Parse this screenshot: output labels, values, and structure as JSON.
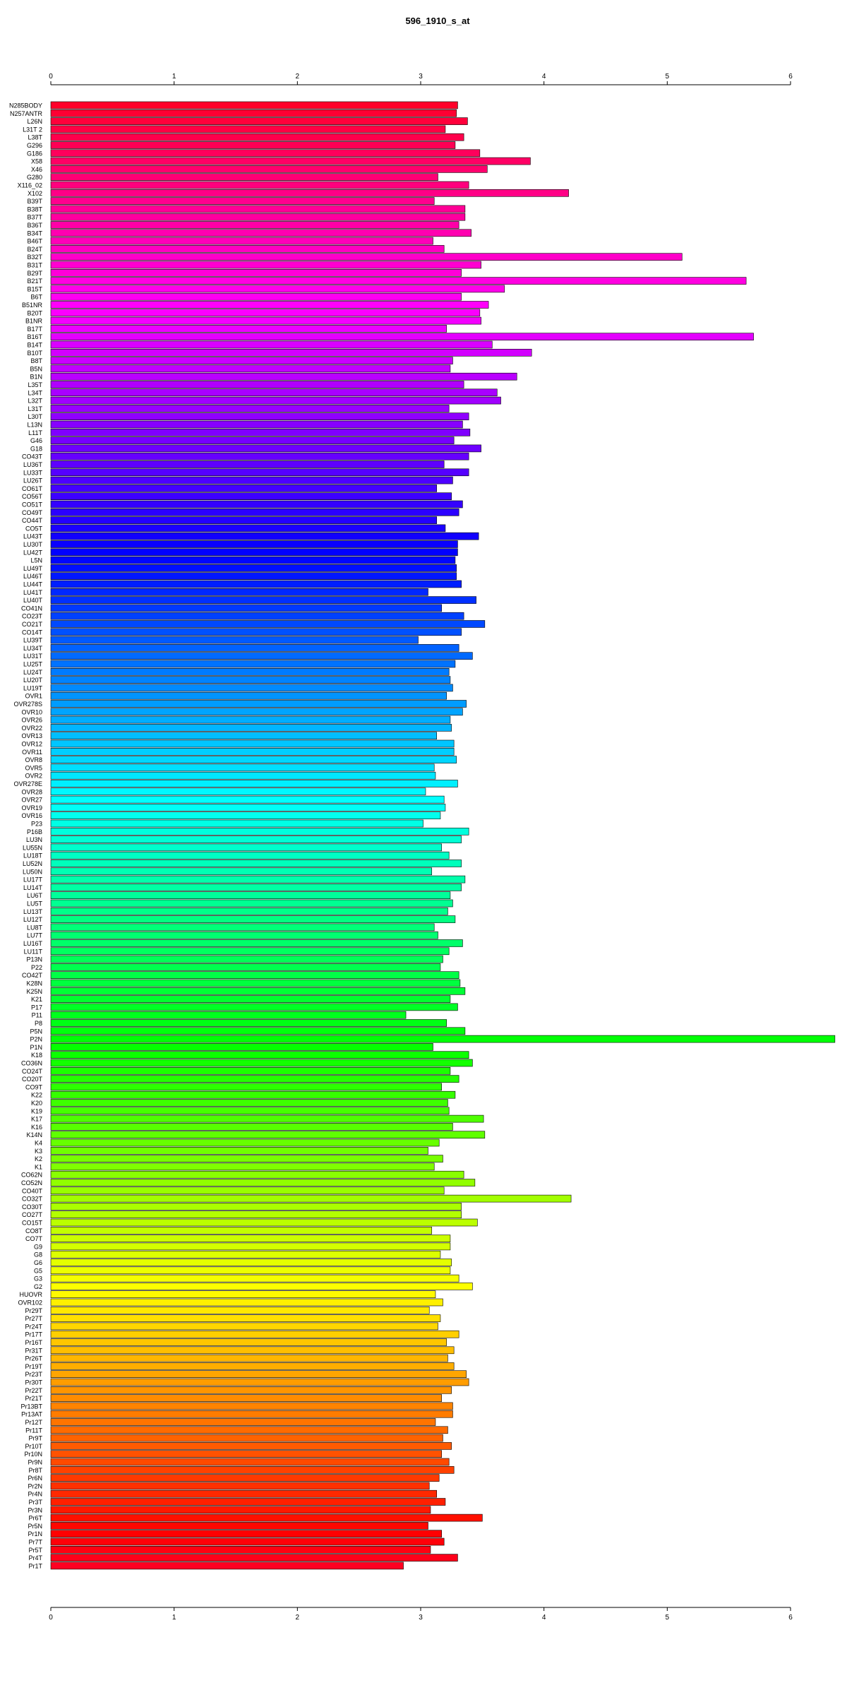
{
  "chart_data": {
    "type": "bar",
    "orientation": "horizontal",
    "title": "596_1910_s_at",
    "xlabel": "",
    "ylabel": "",
    "xlim": [
      0,
      6
    ],
    "xticks": [
      0,
      1,
      2,
      3,
      4,
      5,
      6
    ],
    "grid": false,
    "legend": "none",
    "categories": [
      "N285BODY",
      "N257ANTR",
      "L26N",
      "L31T 2",
      "L38T",
      "G296",
      "G186",
      "X58",
      "X46",
      "G280",
      "X116_02",
      "X102",
      "B39T",
      "B38T",
      "B37T",
      "B36T",
      "B34T",
      "B46T",
      "B24T",
      "B32T",
      "B31T",
      "B29T",
      "B21T",
      "B15T",
      "B6T",
      "B51NR",
      "B20T",
      "B1NR",
      "B17T",
      "B16T",
      "B14T",
      "B10T",
      "B8T",
      "B5N",
      "B1N",
      "L35T",
      "L34T",
      "L32T",
      "L31T",
      "L30T",
      "L13N",
      "L11T",
      "G46",
      "G18",
      "CO43T",
      "LU36T",
      "LU33T",
      "LU26T",
      "CO61T",
      "CO56T",
      "CO51T",
      "CO49T",
      "CO44T",
      "CO5T",
      "LU43T",
      "LU30T",
      "LU42T",
      "L5N",
      "LU49T",
      "LU46T",
      "LU44T",
      "LU41T",
      "LU40T",
      "CO41N",
      "CO23T",
      "CO21T",
      "CO14T",
      "LU39T",
      "LU34T",
      "LU31T",
      "LU25T",
      "LU24T",
      "LU20T",
      "LU19T",
      "OVR1",
      "OVR278S",
      "OVR10",
      "OVR26",
      "OVR22",
      "OVR13",
      "OVR12",
      "OVR11",
      "OVR8",
      "OVR5",
      "OVR2",
      "OVR278E",
      "OVR28",
      "OVR27",
      "OVR19",
      "OVR16",
      "P23",
      "P16B",
      "LU3N",
      "LU55N",
      "LU18T",
      "LU52N",
      "LU50N",
      "LU17T",
      "LU14T",
      "LU6T",
      "LU5T",
      "LU13T",
      "LU12T",
      "LU8T",
      "LU7T",
      "LU16T",
      "LU11T",
      "P13N",
      "P22",
      "CO42T",
      "K28N",
      "K25N",
      "K21",
      "P17",
      "P11",
      "P8",
      "P5N",
      "P2N",
      "P1N",
      "K18",
      "CO36N",
      "CO24T",
      "CO20T",
      "CO9T",
      "K22",
      "K20",
      "K19",
      "K17",
      "K16",
      "K14N",
      "K4",
      "K3",
      "K2",
      "K1",
      "CO62N",
      "CO52N",
      "CO40T",
      "CO32T",
      "CO30T",
      "CO27T",
      "CO15T",
      "CO8T",
      "CO7T",
      "G9",
      "G8",
      "G6",
      "G5",
      "G3",
      "G2",
      "HUOVR",
      "OVR102",
      "Pr29T",
      "Pr27T",
      "Pr24T",
      "Pr17T",
      "Pr16T",
      "Pr31T",
      "Pr26T",
      "Pr19T",
      "Pr23T",
      "Pr30T",
      "Pr22T",
      "Pr21T",
      "Pr13BT",
      "Pr13AT",
      "Pr12T",
      "Pr11T",
      "Pr9T",
      "Pr10T",
      "Pr10N",
      "Pr9N",
      "Pr8T",
      "Pr6N",
      "Pr2N",
      "Pr4N",
      "Pr3T",
      "Pr3N",
      "Pr6T",
      "Pr5N",
      "Pr1N",
      "Pr7T",
      "Pr5T",
      "Pr4T",
      "Pr1T"
    ],
    "values": [
      3.3,
      3.29,
      3.38,
      3.2,
      3.35,
      3.28,
      3.48,
      3.89,
      3.54,
      3.14,
      3.39,
      4.2,
      3.11,
      3.36,
      3.36,
      3.31,
      3.41,
      3.1,
      3.19,
      5.12,
      3.49,
      3.33,
      5.64,
      3.68,
      3.33,
      3.55,
      3.48,
      3.49,
      3.21,
      5.7,
      3.58,
      3.9,
      3.26,
      3.24,
      3.78,
      3.35,
      3.62,
      3.65,
      3.23,
      3.39,
      3.34,
      3.4,
      3.27,
      3.49,
      3.39,
      3.19,
      3.39,
      3.26,
      3.13,
      3.25,
      3.34,
      3.31,
      3.13,
      3.2,
      3.47,
      3.3,
      3.3,
      3.28,
      3.29,
      3.29,
      3.33,
      3.06,
      3.45,
      3.17,
      3.35,
      3.52,
      3.33,
      2.98,
      3.31,
      3.42,
      3.28,
      3.23,
      3.24,
      3.26,
      3.21,
      3.37,
      3.34,
      3.24,
      3.25,
      3.13,
      3.27,
      3.27,
      3.29,
      3.11,
      3.12,
      3.3,
      3.04,
      3.19,
      3.2,
      3.16,
      3.02,
      3.39,
      3.33,
      3.17,
      3.23,
      3.33,
      3.09,
      3.36,
      3.33,
      3.24,
      3.26,
      3.22,
      3.28,
      3.11,
      3.14,
      3.34,
      3.23,
      3.18,
      3.16,
      3.31,
      3.32,
      3.36,
      3.24,
      3.3,
      2.88,
      3.21,
      3.36,
      6.36,
      3.1,
      3.39,
      3.42,
      3.24,
      3.31,
      3.17,
      3.28,
      3.22,
      3.23,
      3.51,
      3.26,
      3.52,
      3.15,
      3.06,
      3.18,
      3.11,
      3.35,
      3.44,
      3.19,
      4.22,
      3.33,
      3.33,
      3.46,
      3.09,
      3.24,
      3.24,
      3.16,
      3.25,
      3.24,
      3.31,
      3.42,
      3.12,
      3.18,
      3.07,
      3.16,
      3.14,
      3.31,
      3.21,
      3.27,
      3.22,
      3.27,
      3.37,
      3.39,
      3.25,
      3.17,
      3.26,
      3.26,
      3.12,
      3.22,
      3.18,
      3.25,
      3.17,
      3.23,
      3.27,
      3.15,
      3.07,
      3.13,
      3.2,
      3.08,
      3.5,
      3.06,
      3.17,
      3.19,
      3.08,
      3.3,
      2.86
    ],
    "bar_color_scale": "rainbow"
  }
}
